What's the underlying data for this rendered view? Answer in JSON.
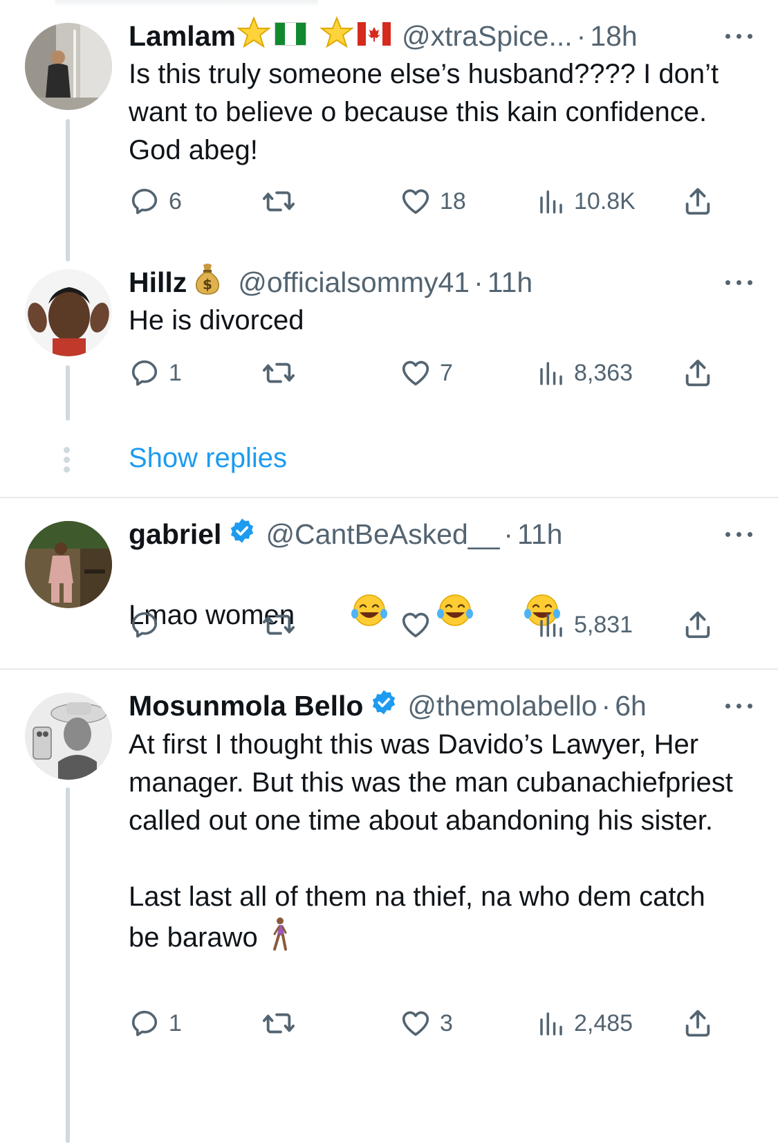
{
  "colors": {
    "accent": "#1d9bf0",
    "secondary_text": "#536471",
    "thread_line": "#cfd9de",
    "verified": "#1d9bf0"
  },
  "tweets": [
    {
      "name": "Lamlam",
      "badges": [
        "star-emoji",
        "nigeria-flag-emoji",
        "star-emoji",
        "canada-flag-emoji"
      ],
      "handle": "@xtraSpice...",
      "dot": "·",
      "time": "18h",
      "text": "Is this truly someone else’s husband???? I don’t want to believe o because this kain confidence. God abeg!",
      "replies": "6",
      "retweets": "",
      "likes": "18",
      "views": "10.8K"
    },
    {
      "name": "Hillz",
      "badges": [
        "money-bag-emoji"
      ],
      "handle": "@officialsommy41",
      "dot": "·",
      "time": "11h",
      "text": "He is divorced",
      "replies": "1",
      "retweets": "",
      "likes": "7",
      "views": "8,363"
    },
    {
      "name": "gabriel",
      "badges": [
        "verified-badge"
      ],
      "handle": "@CantBeAsked__",
      "dot": "·",
      "time": "11h",
      "text": "Lmao women",
      "text_emojis": [
        "tears-of-joy-emoji",
        "tears-of-joy-emoji",
        "tears-of-joy-emoji"
      ],
      "replies": "",
      "retweets": "",
      "likes": "",
      "views": "5,831"
    },
    {
      "name": "Mosunmola Bello",
      "badges": [
        "verified-badge"
      ],
      "handle": "@themolabello",
      "dot": "·",
      "time": "6h",
      "text": "At first I thought this was Davido’s Lawyer, Her manager. But this was the man cubanachiefpriest called out one time about abandoning his sister.\n\nLast last all of them na thief, na who dem catch be barawo",
      "text_emojis": [
        "woman-walking-emoji"
      ],
      "replies": "1",
      "retweets": "",
      "likes": "3",
      "views": "2,485"
    }
  ],
  "show_replies_label": "Show replies"
}
